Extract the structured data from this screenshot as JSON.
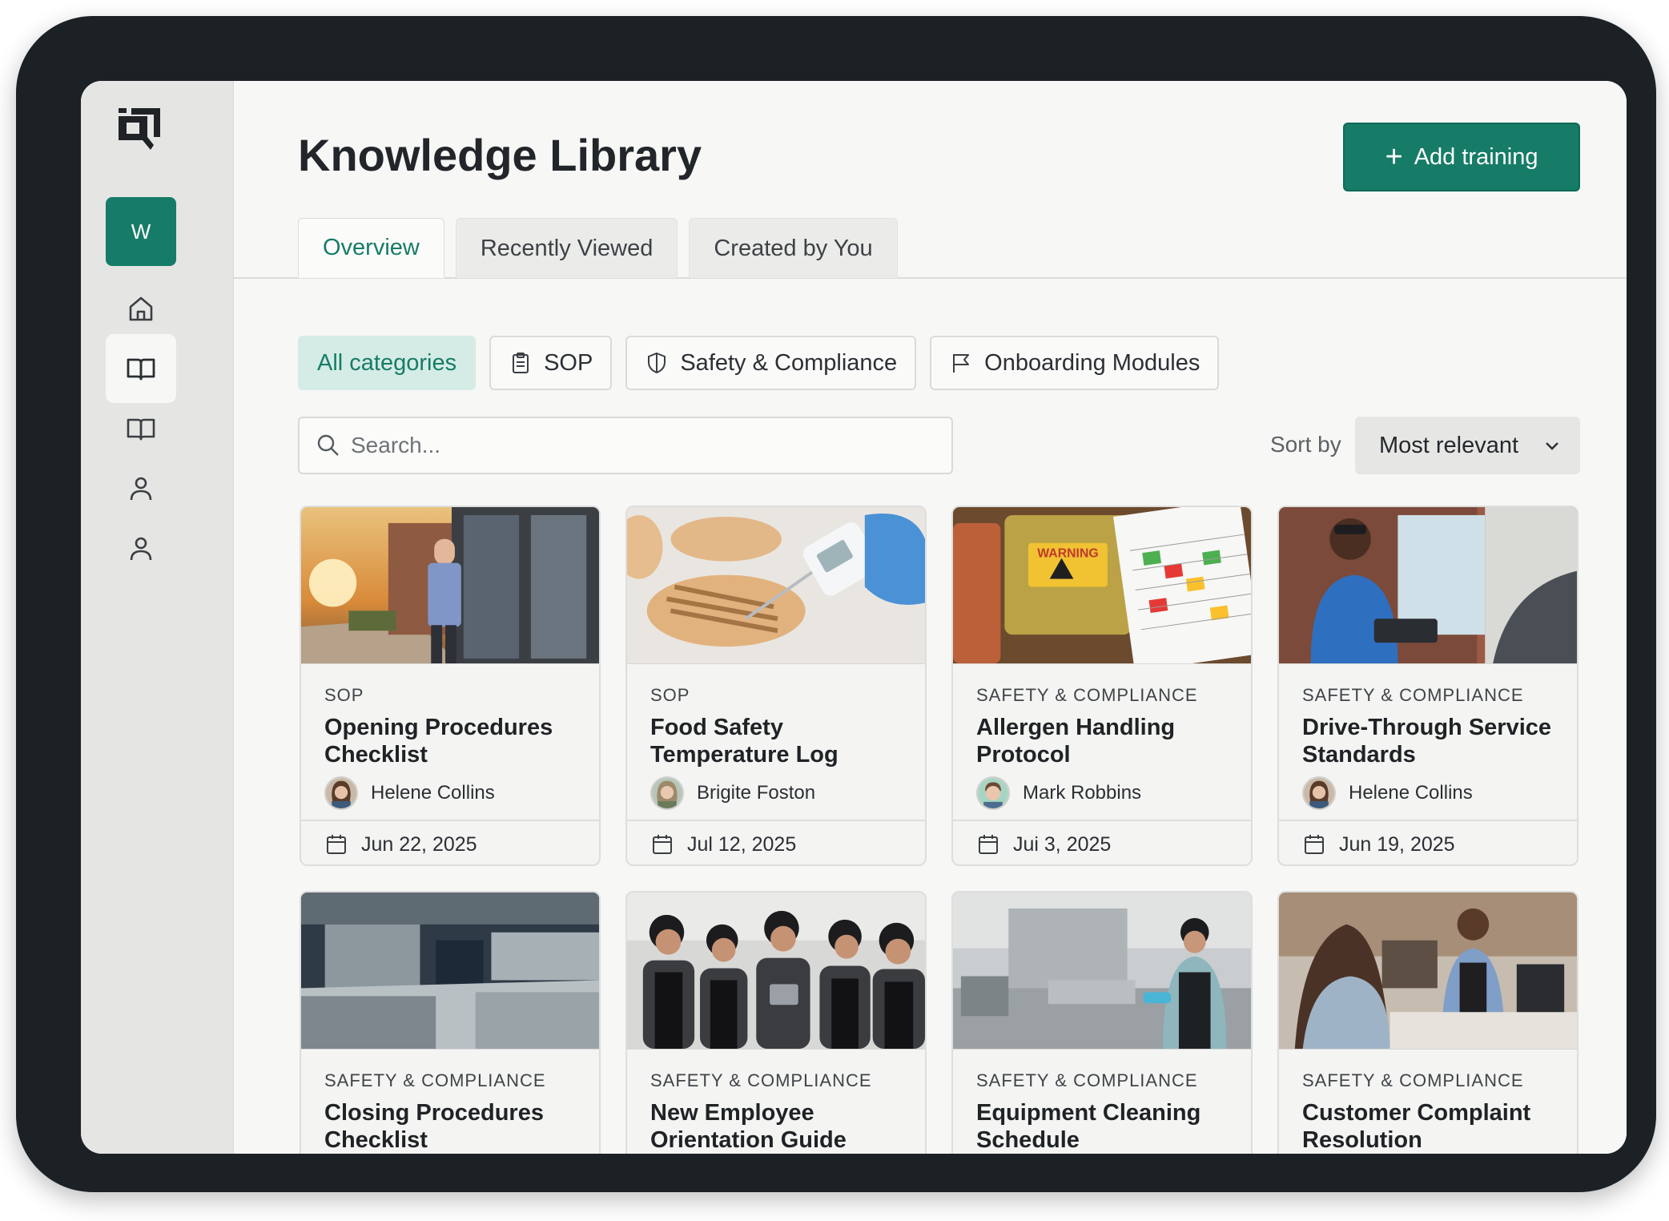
{
  "app": {
    "workspace_initial": "W"
  },
  "header": {
    "title": "Knowledge Library",
    "add_button_label": "Add training"
  },
  "tabs": [
    {
      "label": "Overview",
      "active": true
    },
    {
      "label": "Recently Viewed",
      "active": false
    },
    {
      "label": "Created by You",
      "active": false
    }
  ],
  "filters": [
    {
      "label": "All categories",
      "icon": "",
      "active": true
    },
    {
      "label": "SOP",
      "icon": "clipboard-icon",
      "active": false
    },
    {
      "label": "Safety & Compliance",
      "icon": "shield-icon",
      "active": false
    },
    {
      "label": "Onboarding Modules",
      "icon": "flag-icon",
      "active": false
    }
  ],
  "search": {
    "placeholder": "Search...",
    "value": ""
  },
  "sort": {
    "label": "Sort by",
    "value": "Most relevant"
  },
  "colors": {
    "accent": "#167c67",
    "accent_light": "#d5ece6",
    "sidebar_bg": "#e5e5e4",
    "frame": "#1c2126"
  },
  "cards": [
    {
      "category": "SOP",
      "title": "Opening Procedures Checklist",
      "author": "Helene Collins",
      "date": "Jun 22, 2025",
      "image": "restaurant-entrance-sunrise"
    },
    {
      "category": "SOP",
      "title": "Food Safety Temperature Log",
      "author": "Brigite Foston",
      "date": "Jul 12, 2025",
      "image": "chicken-thermometer"
    },
    {
      "category": "SAFETY & COMPLIANCE",
      "title": "Allergen Handling Protocol",
      "author": "Mark Robbins",
      "date": "Jui 3, 2025",
      "image": "allergen-containers-warning",
      "image_text": "WARNING"
    },
    {
      "category": "SAFETY & COMPLIANCE",
      "title": "Drive-Through Service Standards",
      "author": "Helene Collins",
      "date": "Jun 19, 2025",
      "image": "drive-through-window"
    },
    {
      "category": "SAFETY & COMPLIANCE",
      "title": "Closing Procedures Checklist",
      "image": "stainless-kitchen"
    },
    {
      "category": "SAFETY & COMPLIANCE",
      "title": "New Employee Orientation Guide",
      "image": "team-huddle"
    },
    {
      "category": "SAFETY & COMPLIANCE",
      "title": "Equipment Cleaning Schedule",
      "image": "dishwashing-station"
    },
    {
      "category": "SAFETY & COMPLIANCE",
      "title": "Customer Complaint Resolution",
      "image": "counter-service"
    }
  ]
}
